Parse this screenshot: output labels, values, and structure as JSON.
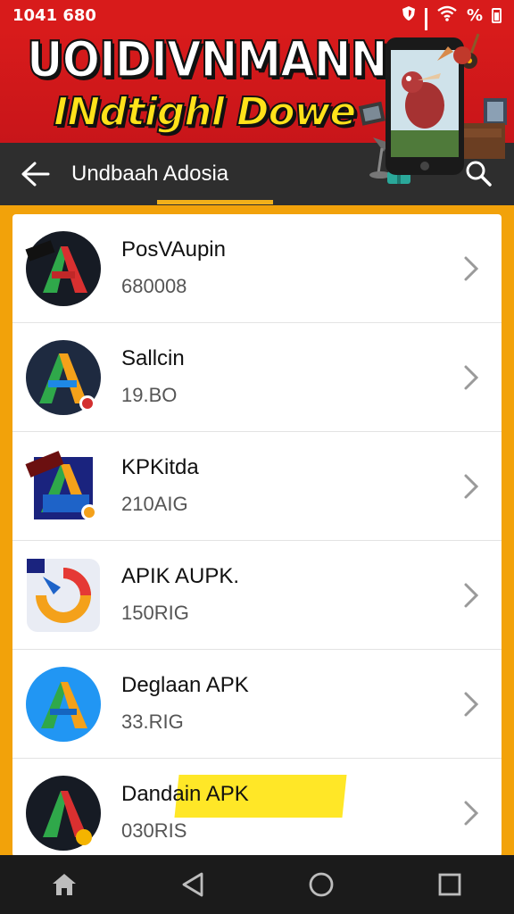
{
  "status_bar": {
    "time": "1041 680",
    "icons": [
      "shield-icon",
      "signal-icon",
      "wifi-icon",
      "battery-icon"
    ],
    "percent": "%"
  },
  "banner": {
    "title": "UOIDIVNMANNIA",
    "subtitle": "INdtighl Dowe"
  },
  "toolbar": {
    "title": "Undbaah Adosia"
  },
  "apps": [
    {
      "name": "PosVAupin",
      "size": "680008",
      "icon": "red-green-a-icon"
    },
    {
      "name": "Sallcin",
      "size": "19.BO",
      "icon": "green-orange-a-icon"
    },
    {
      "name": "KPKitda",
      "size": "210AIG",
      "icon": "green-blue-a-icon"
    },
    {
      "name": "APIK AUPK.",
      "size": "150RIG",
      "icon": "orange-ring-icon"
    },
    {
      "name": "Deglaan APK",
      "size": "33.RIG",
      "icon": "blue-a-icon"
    },
    {
      "name": "Dandain APK",
      "size": "030RIS",
      "icon": "red-green-a-icon"
    }
  ],
  "nav": [
    "home-icon",
    "back-triangle-icon",
    "circle-home-icon",
    "recents-icon"
  ],
  "colors": {
    "status": "#d81b1b",
    "toolbar": "#2e2e2e",
    "accent": "#f2a20a",
    "highlight": "#ffe727"
  }
}
